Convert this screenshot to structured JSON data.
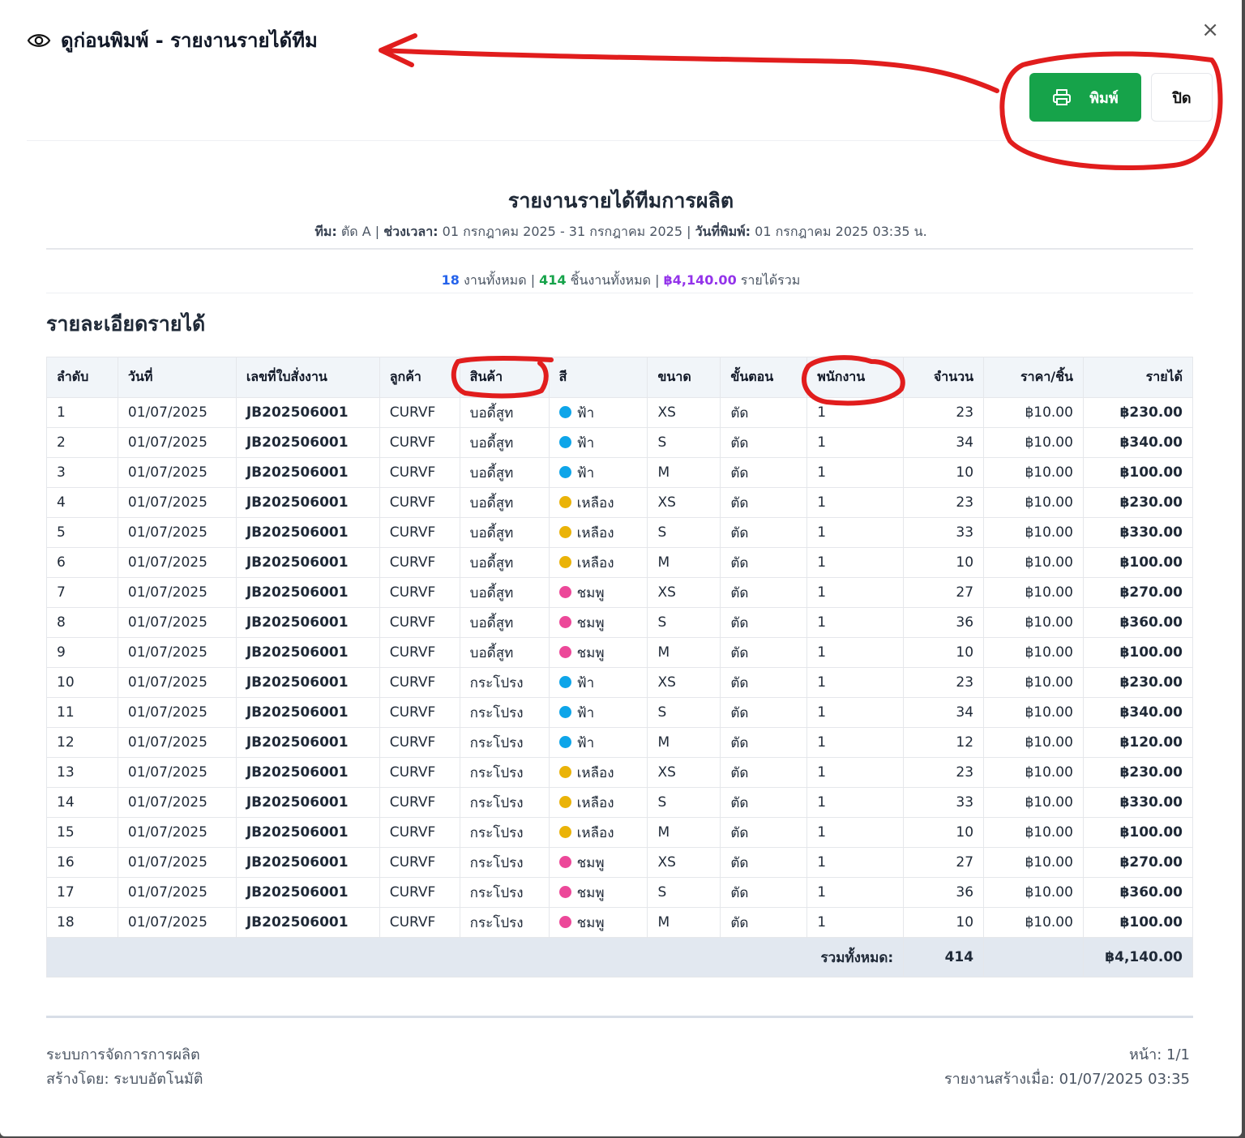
{
  "header": {
    "title": "ดูก่อนพิมพ์ - รายงานรายได้ทีม"
  },
  "buttons": {
    "print": "พิมพ์",
    "close": "ปิด",
    "close_x": "×"
  },
  "report": {
    "title": "รายงานรายได้ทีมการผลิต",
    "meta": {
      "team_label": "ทีม:",
      "team_value": " ตัด A | ",
      "period_label": "ช่วงเวลา:",
      "period_value": " 01 กรกฎาคม 2025 - 31 กรกฎาคม 2025 | ",
      "printed_label": "วันที่พิมพ์:",
      "printed_value": " 01 กรกฎาคม 2025 03:35 น."
    },
    "summary": {
      "jobs": "18",
      "jobs_text": " งานทั้งหมด | ",
      "pieces": "414",
      "pieces_text": " ชิ้นงานทั้งหมด | ",
      "income": "฿4,140.00",
      "income_text": " รายได้รวม"
    },
    "section_title": "รายละเอียดรายได้",
    "columns": [
      "ลำดับ",
      "วันที่",
      "เลขที่ใบสั่งงาน",
      "ลูกค้า",
      "สินค้า",
      "สี",
      "ขนาด",
      "ขั้นตอน",
      "พนักงาน",
      "จำนวน",
      "ราคา/ชิ้น",
      "รายได้"
    ],
    "rows": [
      {
        "no": "1",
        "date": "01/07/2025",
        "job": "JB202506001",
        "customer": "CURVF",
        "product": "บอดี้สูท",
        "color": "ฟ้า",
        "color_hex": "#0ea5e9",
        "size": "XS",
        "step": "ตัด",
        "worker": "1",
        "qty": "23",
        "price": "฿10.00",
        "income": "฿230.00"
      },
      {
        "no": "2",
        "date": "01/07/2025",
        "job": "JB202506001",
        "customer": "CURVF",
        "product": "บอดี้สูท",
        "color": "ฟ้า",
        "color_hex": "#0ea5e9",
        "size": "S",
        "step": "ตัด",
        "worker": "1",
        "qty": "34",
        "price": "฿10.00",
        "income": "฿340.00"
      },
      {
        "no": "3",
        "date": "01/07/2025",
        "job": "JB202506001",
        "customer": "CURVF",
        "product": "บอดี้สูท",
        "color": "ฟ้า",
        "color_hex": "#0ea5e9",
        "size": "M",
        "step": "ตัด",
        "worker": "1",
        "qty": "10",
        "price": "฿10.00",
        "income": "฿100.00"
      },
      {
        "no": "4",
        "date": "01/07/2025",
        "job": "JB202506001",
        "customer": "CURVF",
        "product": "บอดี้สูท",
        "color": "เหลือง",
        "color_hex": "#eab308",
        "size": "XS",
        "step": "ตัด",
        "worker": "1",
        "qty": "23",
        "price": "฿10.00",
        "income": "฿230.00"
      },
      {
        "no": "5",
        "date": "01/07/2025",
        "job": "JB202506001",
        "customer": "CURVF",
        "product": "บอดี้สูท",
        "color": "เหลือง",
        "color_hex": "#eab308",
        "size": "S",
        "step": "ตัด",
        "worker": "1",
        "qty": "33",
        "price": "฿10.00",
        "income": "฿330.00"
      },
      {
        "no": "6",
        "date": "01/07/2025",
        "job": "JB202506001",
        "customer": "CURVF",
        "product": "บอดี้สูท",
        "color": "เหลือง",
        "color_hex": "#eab308",
        "size": "M",
        "step": "ตัด",
        "worker": "1",
        "qty": "10",
        "price": "฿10.00",
        "income": "฿100.00"
      },
      {
        "no": "7",
        "date": "01/07/2025",
        "job": "JB202506001",
        "customer": "CURVF",
        "product": "บอดี้สูท",
        "color": "ชมพู",
        "color_hex": "#ec4899",
        "size": "XS",
        "step": "ตัด",
        "worker": "1",
        "qty": "27",
        "price": "฿10.00",
        "income": "฿270.00"
      },
      {
        "no": "8",
        "date": "01/07/2025",
        "job": "JB202506001",
        "customer": "CURVF",
        "product": "บอดี้สูท",
        "color": "ชมพู",
        "color_hex": "#ec4899",
        "size": "S",
        "step": "ตัด",
        "worker": "1",
        "qty": "36",
        "price": "฿10.00",
        "income": "฿360.00"
      },
      {
        "no": "9",
        "date": "01/07/2025",
        "job": "JB202506001",
        "customer": "CURVF",
        "product": "บอดี้สูท",
        "color": "ชมพู",
        "color_hex": "#ec4899",
        "size": "M",
        "step": "ตัด",
        "worker": "1",
        "qty": "10",
        "price": "฿10.00",
        "income": "฿100.00"
      },
      {
        "no": "10",
        "date": "01/07/2025",
        "job": "JB202506001",
        "customer": "CURVF",
        "product": "กระโปรง",
        "color": "ฟ้า",
        "color_hex": "#0ea5e9",
        "size": "XS",
        "step": "ตัด",
        "worker": "1",
        "qty": "23",
        "price": "฿10.00",
        "income": "฿230.00"
      },
      {
        "no": "11",
        "date": "01/07/2025",
        "job": "JB202506001",
        "customer": "CURVF",
        "product": "กระโปรง",
        "color": "ฟ้า",
        "color_hex": "#0ea5e9",
        "size": "S",
        "step": "ตัด",
        "worker": "1",
        "qty": "34",
        "price": "฿10.00",
        "income": "฿340.00"
      },
      {
        "no": "12",
        "date": "01/07/2025",
        "job": "JB202506001",
        "customer": "CURVF",
        "product": "กระโปรง",
        "color": "ฟ้า",
        "color_hex": "#0ea5e9",
        "size": "M",
        "step": "ตัด",
        "worker": "1",
        "qty": "12",
        "price": "฿10.00",
        "income": "฿120.00"
      },
      {
        "no": "13",
        "date": "01/07/2025",
        "job": "JB202506001",
        "customer": "CURVF",
        "product": "กระโปรง",
        "color": "เหลือง",
        "color_hex": "#eab308",
        "size": "XS",
        "step": "ตัด",
        "worker": "1",
        "qty": "23",
        "price": "฿10.00",
        "income": "฿230.00"
      },
      {
        "no": "14",
        "date": "01/07/2025",
        "job": "JB202506001",
        "customer": "CURVF",
        "product": "กระโปรง",
        "color": "เหลือง",
        "color_hex": "#eab308",
        "size": "S",
        "step": "ตัด",
        "worker": "1",
        "qty": "33",
        "price": "฿10.00",
        "income": "฿330.00"
      },
      {
        "no": "15",
        "date": "01/07/2025",
        "job": "JB202506001",
        "customer": "CURVF",
        "product": "กระโปรง",
        "color": "เหลือง",
        "color_hex": "#eab308",
        "size": "M",
        "step": "ตัด",
        "worker": "1",
        "qty": "10",
        "price": "฿10.00",
        "income": "฿100.00"
      },
      {
        "no": "16",
        "date": "01/07/2025",
        "job": "JB202506001",
        "customer": "CURVF",
        "product": "กระโปรง",
        "color": "ชมพู",
        "color_hex": "#ec4899",
        "size": "XS",
        "step": "ตัด",
        "worker": "1",
        "qty": "27",
        "price": "฿10.00",
        "income": "฿270.00"
      },
      {
        "no": "17",
        "date": "01/07/2025",
        "job": "JB202506001",
        "customer": "CURVF",
        "product": "กระโปรง",
        "color": "ชมพู",
        "color_hex": "#ec4899",
        "size": "S",
        "step": "ตัด",
        "worker": "1",
        "qty": "36",
        "price": "฿10.00",
        "income": "฿360.00"
      },
      {
        "no": "18",
        "date": "01/07/2025",
        "job": "JB202506001",
        "customer": "CURVF",
        "product": "กระโปรง",
        "color": "ชมพู",
        "color_hex": "#ec4899",
        "size": "M",
        "step": "ตัด",
        "worker": "1",
        "qty": "10",
        "price": "฿10.00",
        "income": "฿100.00"
      }
    ],
    "total": {
      "label": "รวมทั้งหมด:",
      "qty": "414",
      "income": "฿4,140.00"
    }
  },
  "footer": {
    "system": "ระบบการจัดการการผลิต",
    "created_by": "สร้างโดย: ระบบอัตโนมัติ",
    "page": "หน้า: 1/1",
    "created_at": "รายงานสร้างเมื่อ: 01/07/2025 03:35"
  },
  "colors": {
    "print_button": "#16a34a",
    "annotation": "#e11d1d"
  },
  "icons": {
    "title": "eye-icon",
    "print": "printer-icon",
    "close": "close-icon"
  }
}
